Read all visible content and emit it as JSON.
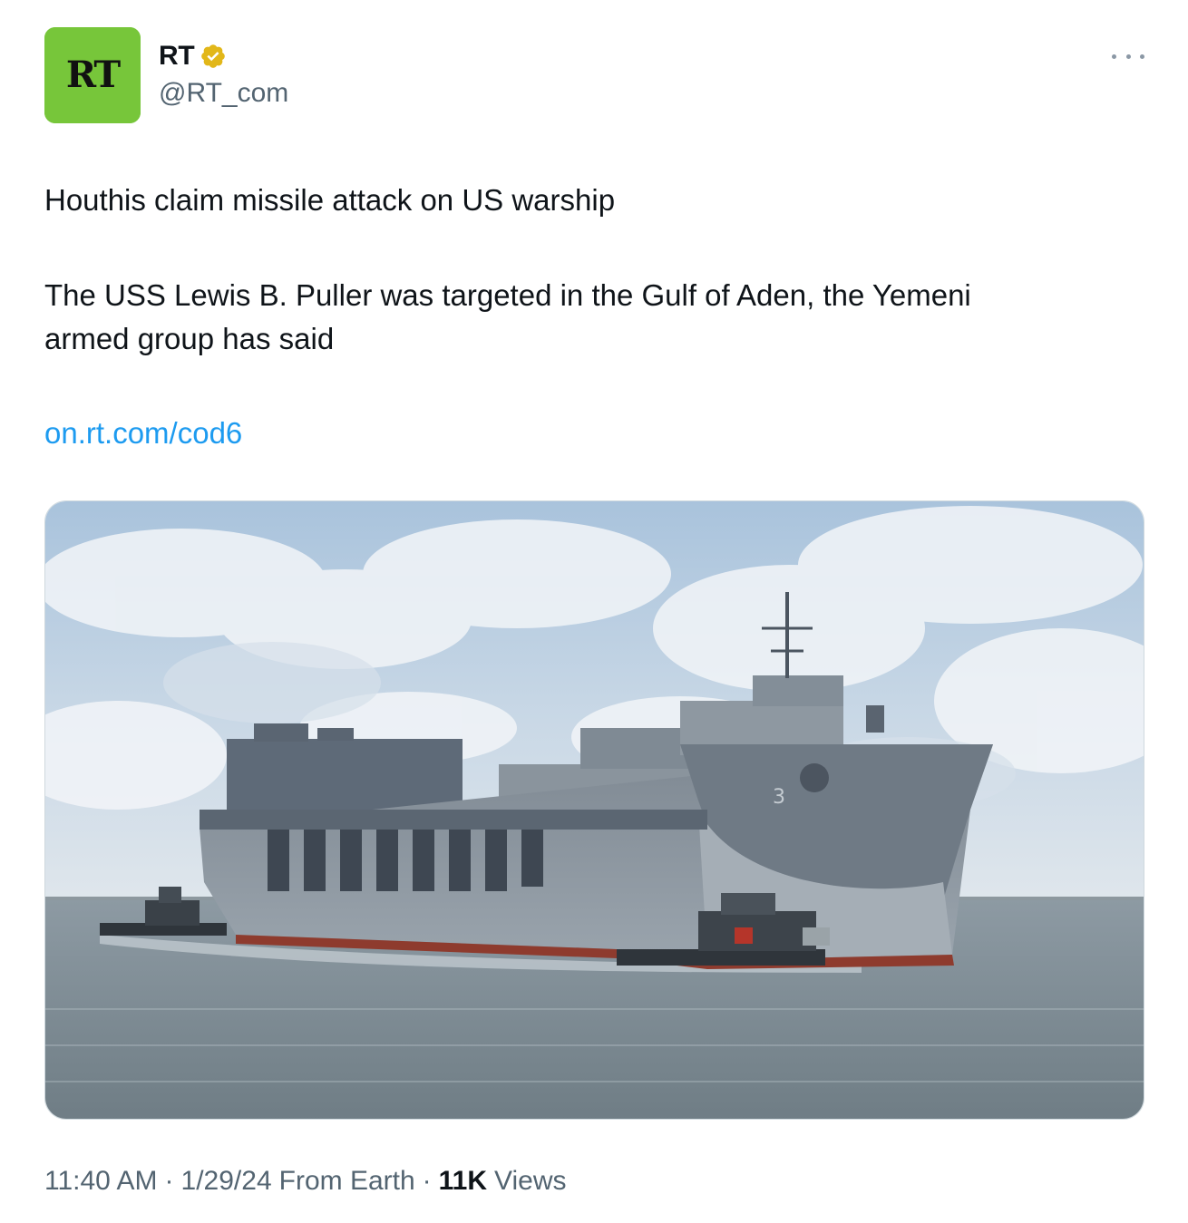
{
  "author": {
    "display_name": "RT",
    "handle": "@RT_com",
    "avatar_text": "RT",
    "avatar_color": "#77c63a",
    "verified_badge_color": "#e2b719",
    "avatar_icon": "rt-logo",
    "verified_icon": "verified-badge-icon",
    "more_icon": "more-options-icon"
  },
  "tweet": {
    "headline": "Houthis claim missile attack on US warship",
    "body_line1": "The USS Lewis B. Puller was targeted in the Gulf of Aden, the Yemeni",
    "body_line2": "armed group has said",
    "link": "on.rt.com/cod6",
    "link_color": "#1d9bf0"
  },
  "meta": {
    "time": "11:40 AM",
    "date": "1/29/24",
    "source": "From Earth",
    "separator": "·",
    "views_count": "11K",
    "views_label": "Views"
  }
}
